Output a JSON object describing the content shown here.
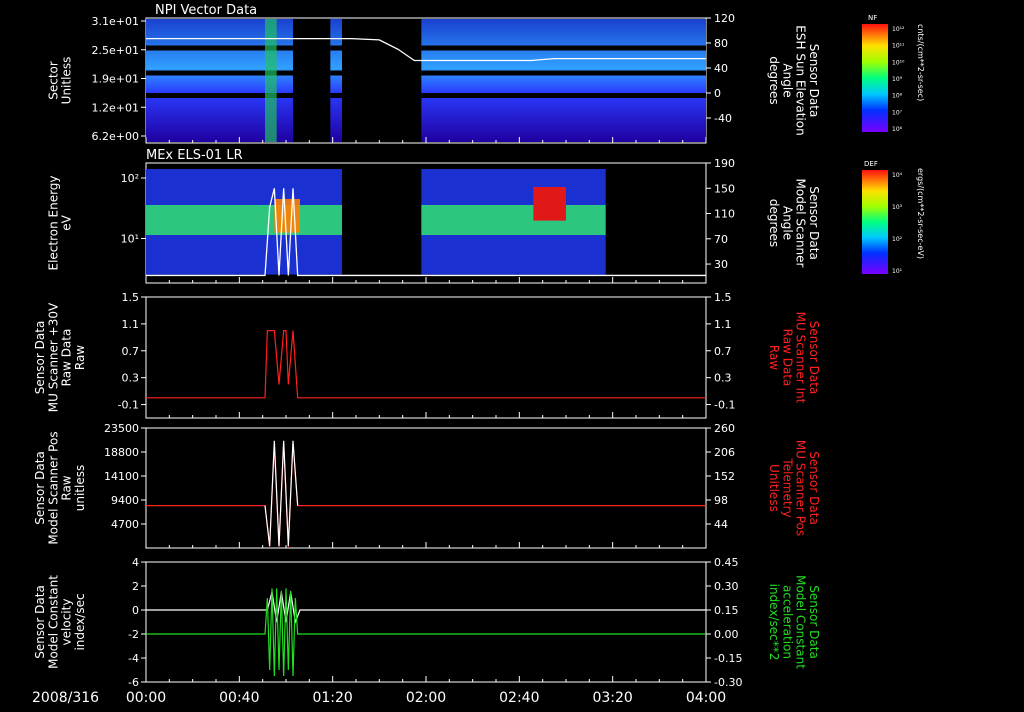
{
  "date_label": "2008/316",
  "time_axis": {
    "ticks": [
      "00:00",
      "00:40",
      "01:20",
      "02:00",
      "02:40",
      "03:20",
      "04:00"
    ],
    "range_minutes": [
      0,
      240
    ]
  },
  "colorbars": [
    {
      "title": "NF",
      "ticks": [
        "10¹²",
        "10¹¹",
        "10¹⁰",
        "10⁹",
        "10⁸",
        "10⁷",
        "10⁶"
      ],
      "unit": "cnts/(cm**2-sr-sec)"
    },
    {
      "title": "DEF",
      "ticks": [
        "10⁴",
        "10³",
        "10²",
        "10¹"
      ],
      "unit": "ergs/(cm**2-sr-sec-eV)"
    }
  ],
  "chart_data": [
    {
      "type": "heatmap",
      "title": "NPI Vector Data",
      "ylabel": "Sector\nUnitless",
      "yticks": [
        "3.1e+01",
        "2.5e+01",
        "1.9e+01",
        "1.2e+01",
        "6.2e+00"
      ],
      "y2label": "Sensor Data\nESH Sun Elevation\nAngle\ndegrees",
      "y2ticks": [
        120,
        80,
        40,
        0,
        -40
      ],
      "y2lim": [
        -80,
        120
      ],
      "data_gaps_minutes": [
        [
          63,
          79
        ],
        [
          84,
          118
        ]
      ],
      "line": {
        "color": "#ffffff",
        "x": [
          0,
          88,
          100,
          108,
          115,
          165,
          175,
          240
        ],
        "y": [
          87,
          87,
          85,
          70,
          52,
          52,
          55,
          55
        ]
      }
    },
    {
      "type": "heatmap",
      "title": "MEx ELS-01 LR",
      "ylabel": "Electron Energy\neV",
      "yticks": [
        "10²",
        "10¹"
      ],
      "y2label": "Sensor Data\nModel Scanner\nAngle\ndegrees",
      "y2ticks": [
        190,
        150,
        110,
        70,
        30
      ],
      "y2lim": [
        0,
        190
      ],
      "data_gaps_minutes": [
        [
          84,
          118
        ],
        [
          197,
          240
        ]
      ],
      "line": {
        "color": "#ffffff",
        "x": [
          0,
          51,
          53,
          55,
          57,
          59,
          61,
          63,
          65,
          67,
          240
        ],
        "y": [
          12,
          12,
          120,
          150,
          12,
          150,
          12,
          150,
          12,
          12,
          12
        ]
      }
    },
    {
      "type": "line",
      "ylabel": "Sensor Data\nMU Scanner +30V\nRaw Data\nRaw",
      "yticks": [
        1.5,
        1.1,
        0.7,
        0.3,
        -0.1
      ],
      "ylim": [
        -0.3,
        1.5
      ],
      "y2label": "Sensor Data\nMU Scanner Int\nRaw Data\nRaw",
      "y2ticks": [
        1.5,
        1.1,
        0.7,
        0.3,
        -0.1
      ],
      "series": [
        {
          "color": "#ff2020",
          "x": [
            0,
            51,
            52,
            55,
            57,
            59,
            60,
            61,
            63,
            65,
            240
          ],
          "y": [
            0,
            0,
            1,
            1,
            0.2,
            1,
            1,
            0.2,
            1,
            0,
            0
          ]
        }
      ]
    },
    {
      "type": "line",
      "ylabel": "Sensor Data\nModel Scanner Pos\nRaw\nunitless",
      "yticks": [
        23500,
        18800,
        14100,
        9400,
        4700
      ],
      "ylim": [
        0,
        23500
      ],
      "y2label": "Sensor Data\nMU Scanner Pos\nTelemetry\nUnitless",
      "y2ticks": [
        260,
        206,
        152,
        98,
        44
      ],
      "series": [
        {
          "color": "#ff2020",
          "x": [
            0,
            51,
            53,
            55,
            57,
            59,
            61,
            63,
            65,
            240
          ],
          "y": [
            8300,
            8300,
            200,
            20500,
            200,
            20500,
            200,
            20500,
            8300,
            8300
          ]
        },
        {
          "color": "#ffffff",
          "x": [
            51,
            53,
            55,
            57,
            59,
            61,
            63,
            65
          ],
          "y": [
            8300,
            400,
            21000,
            400,
            21000,
            400,
            21000,
            8300
          ]
        }
      ]
    },
    {
      "type": "line",
      "ylabel": "Sensor Data\nModel Constant\nvelocity\nindex/sec",
      "yticks": [
        4,
        2,
        0,
        -2,
        -4,
        -6
      ],
      "ylim": [
        -6,
        4
      ],
      "y2label": "Sensor Data\nModel Constant\nacceleration\nindex/sec**2",
      "y2ticks": [
        "0.45",
        "0.30",
        "0.15",
        "0.00",
        "-0.15",
        "-0.30"
      ],
      "series": [
        {
          "color": "#ffffff",
          "x": [
            0,
            52,
            54,
            56,
            58,
            60,
            62,
            64,
            66,
            240
          ],
          "y": [
            0,
            0,
            1.5,
            -1,
            1.5,
            -1,
            1.5,
            -1,
            0,
            0
          ]
        },
        {
          "color": "#22dd22",
          "x": [
            0,
            51,
            52,
            53,
            54,
            55,
            56,
            57,
            58,
            59,
            60,
            61,
            62,
            63,
            64,
            65,
            66,
            240
          ],
          "y": [
            -2,
            -2,
            1,
            -5,
            1.8,
            -5.5,
            1.8,
            -5,
            1.6,
            -5.5,
            1.8,
            -5,
            1.6,
            -5.5,
            1,
            -2,
            -2,
            -2
          ]
        }
      ]
    }
  ]
}
